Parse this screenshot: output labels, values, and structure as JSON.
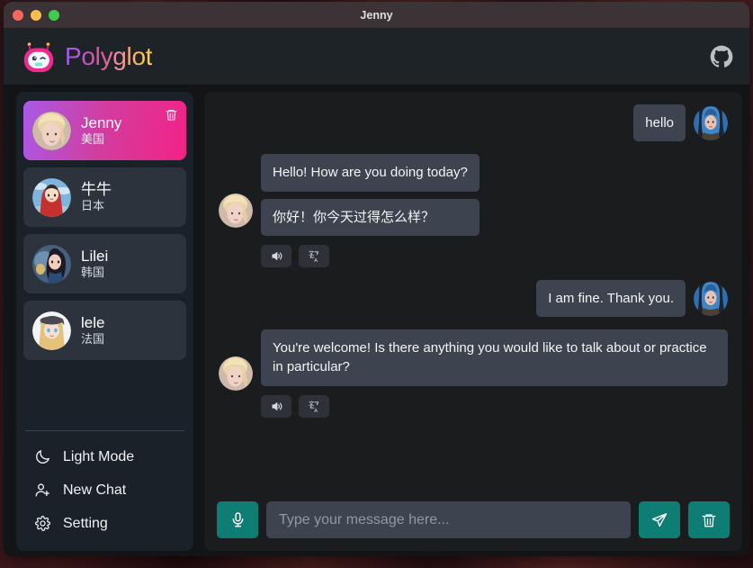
{
  "window": {
    "title": "Jenny",
    "traffic_lights": [
      "close",
      "minimize",
      "maximize"
    ]
  },
  "header": {
    "brand_name": "Polyglot",
    "logo_icon": "robot-mascot-icon",
    "github_icon": "github-icon"
  },
  "sidebar": {
    "contacts": [
      {
        "name": "Jenny",
        "language": "美国",
        "active": true,
        "avatar": "avatar-jenny",
        "delete_icon": "trash-icon"
      },
      {
        "name": "牛牛",
        "language": "日本",
        "active": false,
        "avatar": "avatar-niuniu",
        "delete_icon": "trash-icon"
      },
      {
        "name": "Lilei",
        "language": "韩国",
        "active": false,
        "avatar": "avatar-lilei",
        "delete_icon": "trash-icon"
      },
      {
        "name": "lele",
        "language": "法国",
        "active": false,
        "avatar": "avatar-lele",
        "delete_icon": "trash-icon"
      }
    ],
    "menu": [
      {
        "label": "Light Mode",
        "icon": "moon-icon"
      },
      {
        "label": "New Chat",
        "icon": "user-plus-icon"
      },
      {
        "label": "Setting",
        "icon": "gear-icon"
      }
    ]
  },
  "chat": {
    "messages": [
      {
        "role": "user",
        "avatar": "avatar-user",
        "bubbles": [
          "hello"
        ],
        "actions": []
      },
      {
        "role": "bot",
        "avatar": "avatar-jenny",
        "bubbles": [
          "Hello! How are you doing today?",
          "你好！你今天过得怎么样？"
        ],
        "actions": [
          "speaker-icon",
          "translate-icon"
        ]
      },
      {
        "role": "user",
        "avatar": "avatar-user",
        "bubbles": [
          "I am fine. Thank you."
        ],
        "actions": []
      },
      {
        "role": "bot",
        "avatar": "avatar-jenny",
        "bubbles": [
          "You're welcome! Is there anything you would like to talk about or practice in particular?"
        ],
        "actions": [
          "speaker-icon",
          "translate-icon"
        ]
      }
    ]
  },
  "composer": {
    "mic_icon": "microphone-icon",
    "send_icon": "send-paper-plane-icon",
    "clear_icon": "trash-icon",
    "input_value": "",
    "input_placeholder": "Type your message here..."
  },
  "colors": {
    "accent_teal": "#0e7d74",
    "gradient_start": "#a95ae8",
    "gradient_end": "#f32286",
    "bubble": "#3d434f",
    "sidebar_bg": "#1b2129",
    "chat_bg": "#1a1c1e"
  }
}
